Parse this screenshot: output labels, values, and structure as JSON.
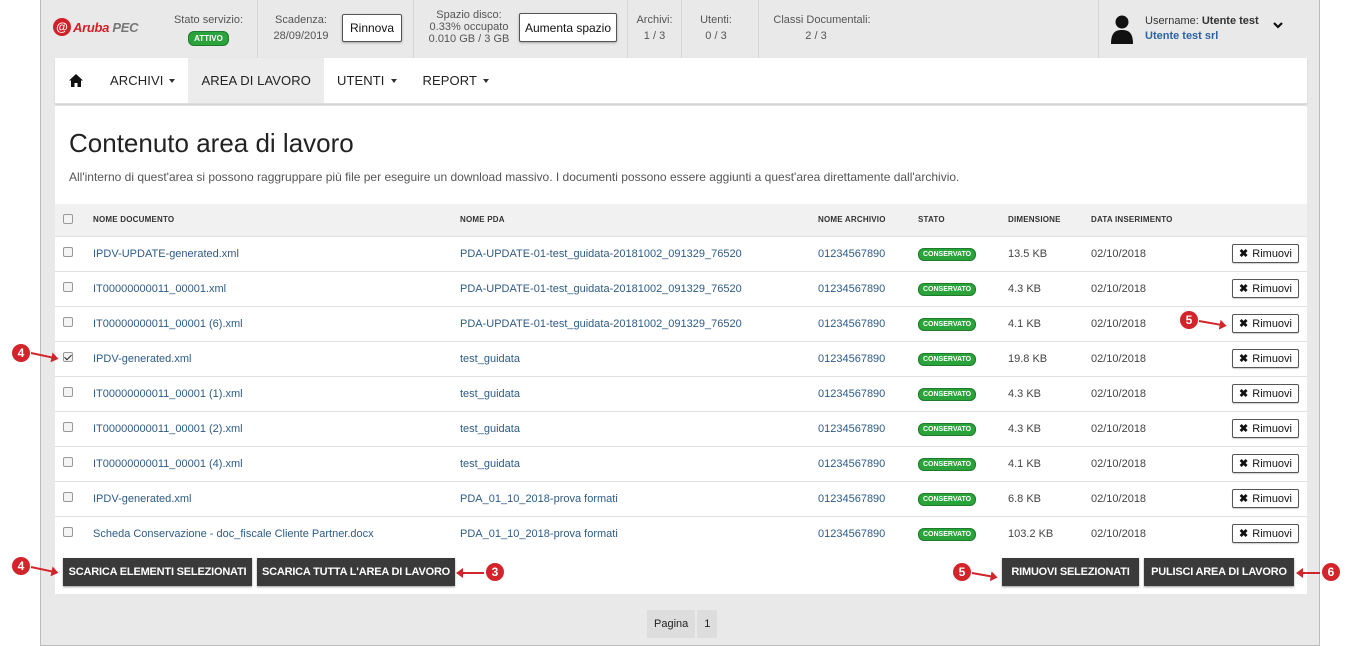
{
  "header": {
    "logo": {
      "name": "Aruba",
      "suffix": "PEC"
    },
    "service_status": {
      "label": "Stato servizio:",
      "badge": "ATTIVO"
    },
    "expiry": {
      "label": "Scadenza:",
      "value": "28/09/2019",
      "button": "Rinnova"
    },
    "disk": {
      "label": "Spazio disco:",
      "line1": "0.33% occupato",
      "line2": "0.010 GB / 3 GB",
      "button": "Aumenta spazio"
    },
    "archives": {
      "label": "Archivi:",
      "value": "1 / 3"
    },
    "users": {
      "label": "Utenti:",
      "value": "0 / 3"
    },
    "classes": {
      "label": "Classi Documentali:",
      "value": "2 / 3"
    },
    "user": {
      "label": "Username:",
      "name": "Utente test",
      "company": "Utente test srl"
    }
  },
  "nav": {
    "items": [
      {
        "label": "ARCHIVI",
        "dropdown": true
      },
      {
        "label": "AREA DI LAVORO",
        "dropdown": false,
        "active": true
      },
      {
        "label": "UTENTI",
        "dropdown": true
      },
      {
        "label": "REPORT",
        "dropdown": true
      }
    ]
  },
  "main": {
    "title": "Contenuto area di lavoro",
    "description": "All'interno di quest'area si possono raggruppare più file per eseguire un download massivo. I documenti possono essere aggiunti a quest'area direttamente dall'archivio.",
    "columns": [
      "NOME DOCUMENTO",
      "NOME PDA",
      "NOME ARCHIVIO",
      "STATO",
      "DIMENSIONE",
      "DATA INSERIMENTO"
    ],
    "remove_label": "Rimuovi",
    "rows": [
      {
        "doc": "IPDV-UPDATE-generated.xml",
        "pda": "PDA-UPDATE-01-test_guidata-20181002_091329_76520",
        "archive": "01234567890",
        "status": "CONSERVATO",
        "size": "13.5 KB",
        "date": "02/10/2018",
        "checked": false
      },
      {
        "doc": "IT00000000011_00001.xml",
        "pda": "PDA-UPDATE-01-test_guidata-20181002_091329_76520",
        "archive": "01234567890",
        "status": "CONSERVATO",
        "size": "4.3 KB",
        "date": "02/10/2018",
        "checked": false
      },
      {
        "doc": "IT00000000011_00001 (6).xml",
        "pda": "PDA-UPDATE-01-test_guidata-20181002_091329_76520",
        "archive": "01234567890",
        "status": "CONSERVATO",
        "size": "4.1 KB",
        "date": "02/10/2018",
        "checked": false
      },
      {
        "doc": "IPDV-generated.xml",
        "pda": "test_guidata",
        "archive": "01234567890",
        "status": "CONSERVATO",
        "size": "19.8 KB",
        "date": "02/10/2018",
        "checked": true
      },
      {
        "doc": "IT00000000011_00001 (1).xml",
        "pda": "test_guidata",
        "archive": "01234567890",
        "status": "CONSERVATO",
        "size": "4.3 KB",
        "date": "02/10/2018",
        "checked": false
      },
      {
        "doc": "IT00000000011_00001 (2).xml",
        "pda": "test_guidata",
        "archive": "01234567890",
        "status": "CONSERVATO",
        "size": "4.3 KB",
        "date": "02/10/2018",
        "checked": false
      },
      {
        "doc": "IT00000000011_00001 (4).xml",
        "pda": "test_guidata",
        "archive": "01234567890",
        "status": "CONSERVATO",
        "size": "4.1 KB",
        "date": "02/10/2018",
        "checked": false
      },
      {
        "doc": "IPDV-generated.xml",
        "pda": "PDA_01_10_2018-prova formati",
        "archive": "01234567890",
        "status": "CONSERVATO",
        "size": "6.8 KB",
        "date": "02/10/2018",
        "checked": false
      },
      {
        "doc": "Scheda Conservazione - doc_fiscale Cliente Partner.docx",
        "pda": "PDA_01_10_2018-prova formati",
        "archive": "01234567890",
        "status": "CONSERVATO",
        "size": "103.2 KB",
        "date": "02/10/2018",
        "checked": false
      }
    ],
    "buttons": {
      "download_selected": "SCARICA ELEMENTI SELEZIONATI",
      "download_all": "SCARICA TUTTA L'AREA DI LAVORO",
      "remove_selected": "RIMUOVI SELEZIONATI",
      "clean_area": "PULISCI AREA DI LAVORO"
    }
  },
  "pagination": {
    "label": "Pagina",
    "page": "1"
  },
  "callouts": {
    "c3": "3",
    "c4a": "4",
    "c4b": "4",
    "c5a": "5",
    "c5b": "5",
    "c6": "6"
  },
  "colors": {
    "brand": "#d0202a",
    "status_green": "#29a33a",
    "link": "#2e5b86",
    "callout": "#d2242a"
  }
}
